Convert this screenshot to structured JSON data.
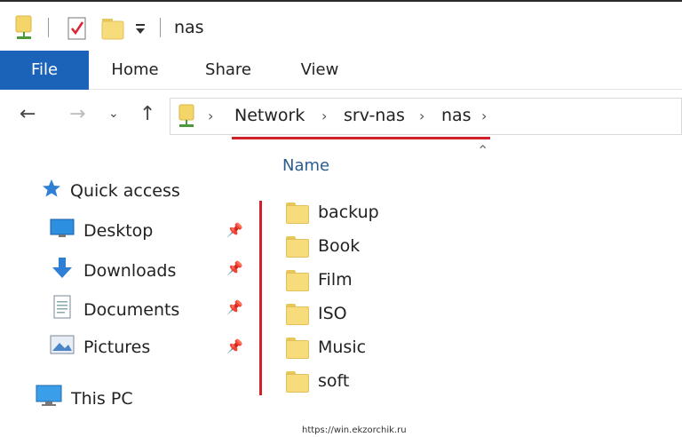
{
  "window": {
    "title": "nas"
  },
  "ribbon": {
    "tabs": [
      {
        "label": "File"
      },
      {
        "label": "Home"
      },
      {
        "label": "Share"
      },
      {
        "label": "View"
      }
    ]
  },
  "address": {
    "crumbs": [
      "Network",
      "srv-nas",
      "nas"
    ]
  },
  "content": {
    "column_header": "Name"
  },
  "nav": {
    "quick_access": "Quick access",
    "items": [
      {
        "label": "Desktop",
        "icon": "desktop-icon"
      },
      {
        "label": "Downloads",
        "icon": "downloads-icon"
      },
      {
        "label": "Documents",
        "icon": "documents-icon"
      },
      {
        "label": "Pictures",
        "icon": "pictures-icon"
      }
    ],
    "this_pc": "This PC"
  },
  "files": [
    {
      "name": "backup"
    },
    {
      "name": "Book"
    },
    {
      "name": "Film"
    },
    {
      "name": "ISO"
    },
    {
      "name": "Music"
    },
    {
      "name": "soft"
    }
  ],
  "watermark": "https://win.ekzorchik.ru",
  "colors": {
    "accent": "#1a63b8",
    "annotation_red": "#d0202a",
    "folder": "#f7dc7c"
  }
}
